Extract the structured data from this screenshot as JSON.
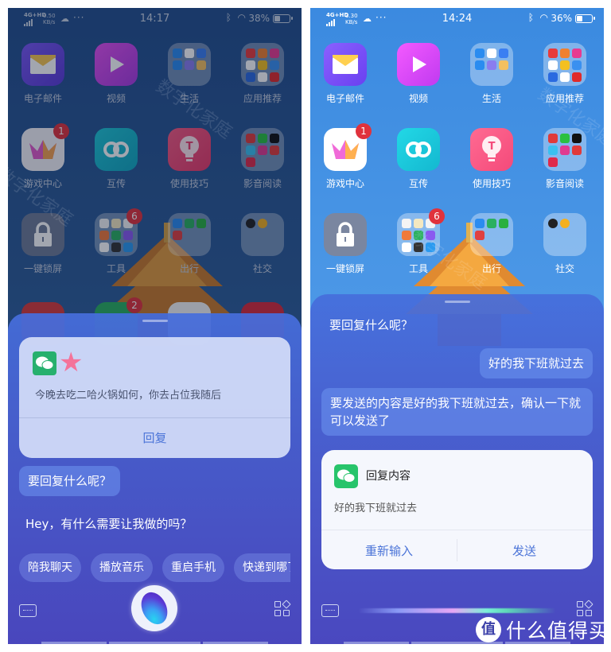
{
  "left_phone": {
    "status": {
      "network": "4G+HD",
      "speed_value": "0.50",
      "speed_unit": "KB/s",
      "more": "···",
      "time": "14:17",
      "battery_pct": "38%"
    },
    "apps": [
      {
        "label": "电子邮件",
        "icon": "mail-icon"
      },
      {
        "label": "视频",
        "icon": "play-icon"
      },
      {
        "label": "生活",
        "icon": "folder-icon"
      },
      {
        "label": "应用推荐",
        "icon": "folder-icon"
      },
      {
        "label": "游戏中心",
        "icon": "crown-icon",
        "badge": "1"
      },
      {
        "label": "互传",
        "icon": "link-rings-icon"
      },
      {
        "label": "使用技巧",
        "icon": "lightbulb-icon"
      },
      {
        "label": "影音阅读",
        "icon": "folder-icon"
      },
      {
        "label": "一键锁屏",
        "icon": "lock-icon"
      },
      {
        "label": "工具",
        "icon": "folder-icon",
        "badge": "6"
      },
      {
        "label": "出行",
        "icon": "folder-icon"
      },
      {
        "label": "社交",
        "icon": "folder-icon"
      }
    ],
    "dock_badge": "2",
    "notification": {
      "app_icon": "wechat-icon",
      "sender_masked": "★",
      "message": "今晚去吃二哈火锅如何，你去占位我随后",
      "reply_label": "回复"
    },
    "assistant_prompt": "要回复什么呢？",
    "assistant_greeting": "Hey，有什么需要让我做的吗？",
    "suggestions": [
      "陪我聊天",
      "播放音乐",
      "重启手机",
      "快递到哪了"
    ]
  },
  "right_phone": {
    "status": {
      "network": "4G+HD",
      "speed_value": "3.30",
      "speed_unit": "KB/s",
      "more": "···",
      "time": "14:24",
      "battery_pct": "36%"
    },
    "apps": [
      {
        "label": "电子邮件",
        "icon": "mail-icon"
      },
      {
        "label": "视频",
        "icon": "play-icon"
      },
      {
        "label": "生活",
        "icon": "folder-icon"
      },
      {
        "label": "应用推荐",
        "icon": "folder-icon"
      },
      {
        "label": "游戏中心",
        "icon": "crown-icon",
        "badge": "1"
      },
      {
        "label": "互传",
        "icon": "link-rings-icon"
      },
      {
        "label": "使用技巧",
        "icon": "lightbulb-icon"
      },
      {
        "label": "影音阅读",
        "icon": "folder-icon"
      },
      {
        "label": "一键锁屏",
        "icon": "lock-icon"
      },
      {
        "label": "工具",
        "icon": "folder-icon",
        "badge": "6"
      },
      {
        "label": "出行",
        "icon": "folder-icon"
      },
      {
        "label": "社交",
        "icon": "folder-icon"
      }
    ],
    "assistant_prompt": "要回复什么呢？",
    "user_reply": "好的我下班就过去",
    "assistant_confirm": "要发送的内容是好的我下班就过去，确认一下就可以发送了",
    "confirm_card": {
      "app_icon": "wechat-icon",
      "title": "回复内容",
      "body": "好的我下班就过去",
      "reinput_label": "重新输入",
      "send_label": "发送"
    }
  },
  "watermark": "数字化家庭",
  "site_logo": {
    "glyph": "值",
    "text": "什么值得买"
  },
  "colors": {
    "accent_blue": "#4b74d8",
    "badge_red": "#e0323c",
    "wechat_green": "#27c46b"
  }
}
